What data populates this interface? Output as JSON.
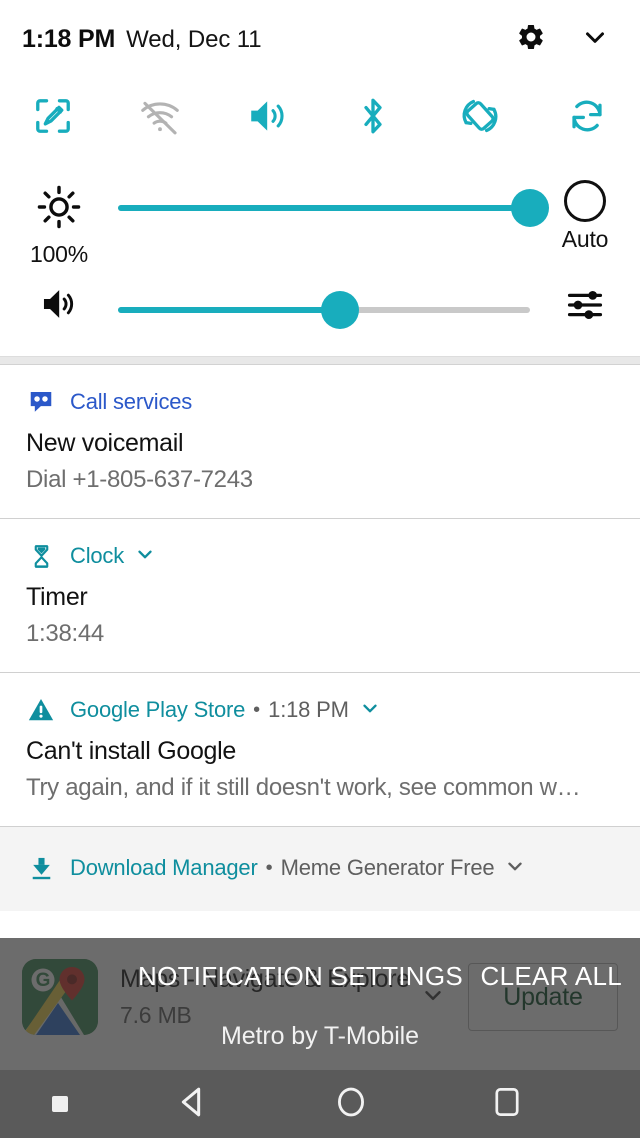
{
  "statusbar": {
    "time": "1:18 PM",
    "date": "Wed, Dec 11",
    "settings_icon": "gear-icon",
    "expand_icon": "chevron-down-icon"
  },
  "quick_settings": {
    "accent_color": "#18adbd",
    "disabled_color": "#b0b0b0",
    "tiles": [
      {
        "name": "capture-plus-tile",
        "icon": "capture-edit-icon",
        "label": "Capture+",
        "enabled": true
      },
      {
        "name": "wifi-tile",
        "icon": "wifi-off-icon",
        "label": "Wi-Fi",
        "enabled": false
      },
      {
        "name": "sound-tile",
        "icon": "volume-up-icon",
        "label": "Sound",
        "enabled": true
      },
      {
        "name": "bluetooth-tile",
        "icon": "bluetooth-icon",
        "label": "Bluetooth",
        "enabled": true
      },
      {
        "name": "auto-rotate-tile",
        "icon": "auto-rotate-icon",
        "label": "Auto-rotate",
        "enabled": true
      },
      {
        "name": "sync-tile",
        "icon": "sync-icon",
        "label": "Sync",
        "enabled": true
      }
    ],
    "brightness": {
      "icon": "brightness-sun-icon",
      "value_label": "100%",
      "percent": 100,
      "auto_label": "Auto",
      "auto_enabled": false
    },
    "volume": {
      "icon": "volume-up-icon",
      "percent": 54,
      "settings_icon": "tuner-sliders-icon"
    }
  },
  "notifications": [
    {
      "name": "notification-call-services",
      "icon": "voicemail-icon",
      "app": "Call services",
      "app_color": "#2b58c9",
      "time": "",
      "expandable": false,
      "title": "New voicemail",
      "text": "Dial +1-805-637-7243"
    },
    {
      "name": "notification-clock",
      "icon": "hourglass-icon",
      "app": "Clock",
      "app_color": "#0f8e9e",
      "time": "",
      "expandable": true,
      "title": "Timer",
      "text": "1:38:44"
    },
    {
      "name": "notification-google-play-store",
      "icon": "warning-triangle-icon",
      "app": "Google Play Store",
      "app_color": "#0f8e9e",
      "time": "1:18 PM",
      "expandable": true,
      "title": "Can't install Google",
      "text": "Try again, and if it still doesn't work, see common w…"
    }
  ],
  "download_notification": {
    "name": "notification-download-manager",
    "icon": "download-icon",
    "app": "Download Manager",
    "app_color": "#0f8e9e",
    "subtitle": "Meme Generator Free",
    "expandable": true
  },
  "app_update": {
    "name": "app-update-row",
    "icon": "google-maps-icon",
    "app_name": "Maps - Navigate & Explore",
    "size": "7.6 MB",
    "button_label": "Update",
    "button_color": "#0d4d2a",
    "expandable": true
  },
  "footer": {
    "notification_settings_label": "NOTIFICATION SETTINGS",
    "clear_all_label": "CLEAR ALL",
    "carrier": "Metro by T-Mobile"
  },
  "navbar": {
    "dot": "notification-dot-icon",
    "back_label": "Back",
    "home_label": "Home",
    "recents_label": "Recents",
    "background": "#5a5a5a"
  }
}
